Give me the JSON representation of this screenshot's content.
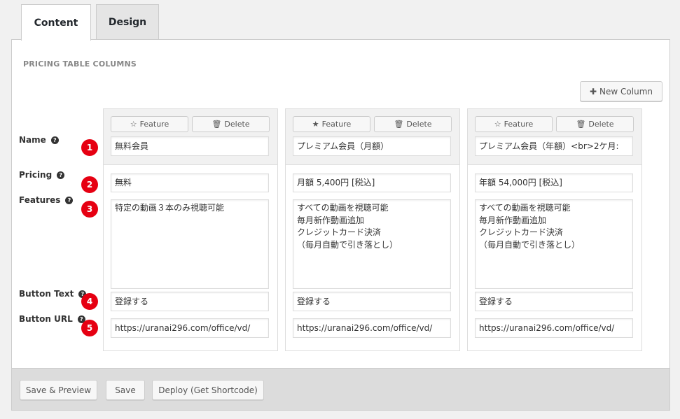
{
  "tabs": [
    {
      "label": "Content"
    },
    {
      "label": "Design"
    }
  ],
  "section_title": "PRICING TABLE COLUMNS",
  "new_column_label": "New Column",
  "row_labels": {
    "name": "Name",
    "pricing": "Pricing",
    "features": "Features",
    "button_text": "Button Text",
    "button_url": "Button URL"
  },
  "markers": [
    "1",
    "2",
    "3",
    "4",
    "5"
  ],
  "column_buttons": {
    "feature": "Feature",
    "delete": "Delete"
  },
  "columns": [
    {
      "featured": false,
      "name": "無料会員",
      "pricing": "無料",
      "features": "特定の動画３本のみ視聴可能",
      "button_text": "登録する",
      "button_url": "https://uranai296.com/office/vd/"
    },
    {
      "featured": true,
      "name": "プレミアム会員（月額）",
      "pricing": "月額 5,400円 [税込]",
      "features": "すべての動画を視聴可能\n毎月新作動画追加\nクレジットカード決済\n（毎月自動で引き落とし）",
      "button_text": "登録する",
      "button_url": "https://uranai296.com/office/vd/"
    },
    {
      "featured": false,
      "name": "プレミアム会員（年額）<br>2ケ月:",
      "pricing": "年額 54,000円 [税込]",
      "features": "すべての動画を視聴可能\n毎月新作動画追加\nクレジットカード決済\n（毎月自動で引き落とし）",
      "button_text": "登録する",
      "button_url": "https://uranai296.com/office/vd/"
    }
  ],
  "footer": {
    "save_preview": "Save & Preview",
    "save": "Save",
    "deploy": "Deploy (Get Shortcode)"
  },
  "icons": {
    "star_outline": "star-outline-icon",
    "star_filled": "star-filled-icon",
    "trash": "trash-icon",
    "plus": "plus-icon",
    "help": "help-icon"
  },
  "colors": {
    "marker_red": "#e60012",
    "footer_bg": "#dcdcdc",
    "column_header_bg": "#f1f1f1"
  }
}
